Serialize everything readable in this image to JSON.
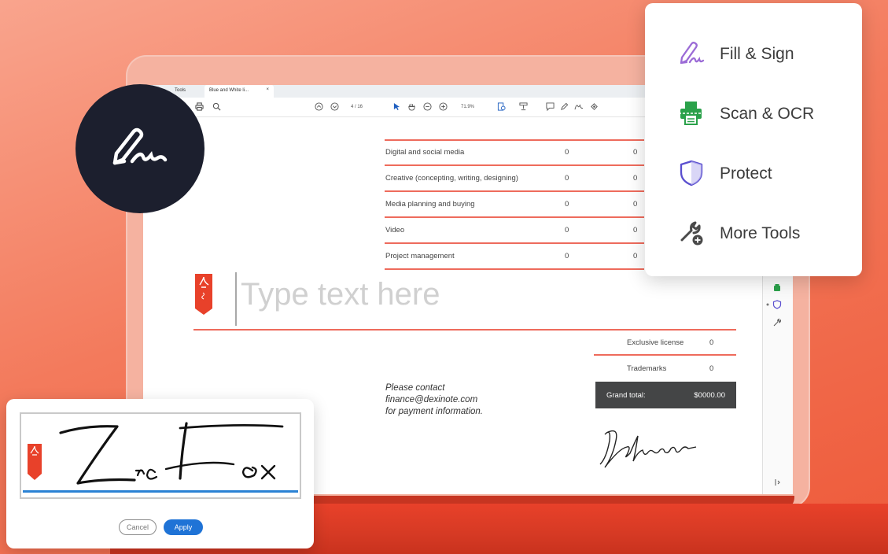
{
  "app": {
    "tabs": {
      "tools": "Tools",
      "file": "Blue and White li...",
      "close": "×"
    },
    "page_indicator": "4 / 16",
    "zoom": "71.9%",
    "colors": {
      "accent": "#ee6b5c",
      "brand_red": "#e8412a",
      "apply_blue": "#1f73d6"
    }
  },
  "document": {
    "table_rows": [
      {
        "label": "Digital and social media",
        "v1": "0",
        "v2": "0"
      },
      {
        "label": "Creative (concepting, writing, designing)",
        "v1": "0",
        "v2": "0"
      },
      {
        "label": "Media planning and buying",
        "v1": "0",
        "v2": "0"
      },
      {
        "label": "Video",
        "v1": "0",
        "v2": "0"
      },
      {
        "label": "Project management",
        "v1": "0",
        "v2": "0"
      }
    ],
    "type_placeholder": "Type text here",
    "summary_rows": [
      {
        "label": "Exclusive license",
        "value": "0"
      },
      {
        "label": "Trademarks",
        "value": "0"
      }
    ],
    "grand_total": {
      "label": "Grand total:",
      "value": "$0000.00"
    },
    "contact": [
      "Please contact",
      "finance@dexinote.com",
      "for payment information."
    ]
  },
  "tool_menu": {
    "items": [
      {
        "label": "Fill & Sign",
        "icon": "fill-sign-icon"
      },
      {
        "label": "Scan & OCR",
        "icon": "scan-ocr-icon"
      },
      {
        "label": "Protect",
        "icon": "shield-icon"
      },
      {
        "label": "More Tools",
        "icon": "wrench-plus-icon"
      }
    ]
  },
  "signature_dialog": {
    "cancel": "Cancel",
    "apply": "Apply"
  }
}
